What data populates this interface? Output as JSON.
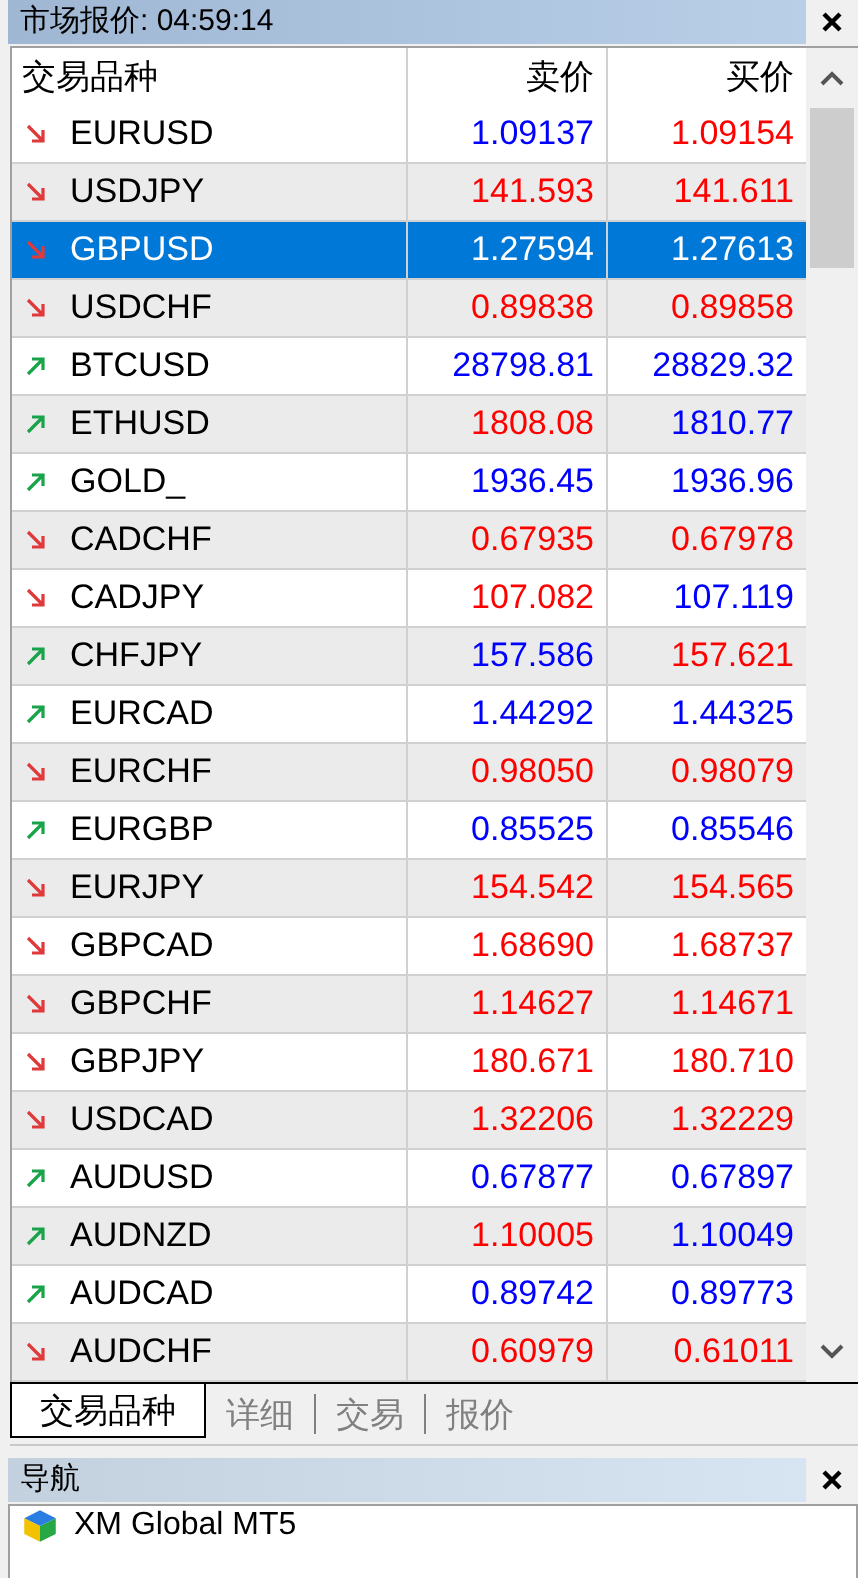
{
  "market_watch": {
    "title": "市场报价: 04:59:14",
    "columns": [
      "交易品种",
      "卖价",
      "买价"
    ],
    "rows": [
      {
        "symbol": "EURUSD",
        "rising": false,
        "bid": "1.09137",
        "bid_up": true,
        "ask": "1.09154",
        "ask_up": false,
        "selected": false
      },
      {
        "symbol": "USDJPY",
        "rising": false,
        "bid": "141.593",
        "bid_up": false,
        "ask": "141.611",
        "ask_up": false,
        "selected": false
      },
      {
        "symbol": "GBPUSD",
        "rising": false,
        "bid": "1.27594",
        "ask": "1.27613",
        "selected": true
      },
      {
        "symbol": "USDCHF",
        "rising": false,
        "bid": "0.89838",
        "bid_up": false,
        "ask": "0.89858",
        "ask_up": false,
        "selected": false
      },
      {
        "symbol": "BTCUSD",
        "rising": true,
        "bid": "28798.81",
        "bid_up": true,
        "ask": "28829.32",
        "ask_up": true,
        "selected": false
      },
      {
        "symbol": "ETHUSD",
        "rising": true,
        "bid": "1808.08",
        "bid_up": false,
        "ask": "1810.77",
        "ask_up": true,
        "selected": false
      },
      {
        "symbol": "GOLD_",
        "rising": true,
        "bid": "1936.45",
        "bid_up": true,
        "ask": "1936.96",
        "ask_up": true,
        "selected": false
      },
      {
        "symbol": "CADCHF",
        "rising": false,
        "bid": "0.67935",
        "bid_up": false,
        "ask": "0.67978",
        "ask_up": false,
        "selected": false
      },
      {
        "symbol": "CADJPY",
        "rising": false,
        "bid": "107.082",
        "bid_up": false,
        "ask": "107.119",
        "ask_up": true,
        "selected": false
      },
      {
        "symbol": "CHFJPY",
        "rising": true,
        "bid": "157.586",
        "bid_up": true,
        "ask": "157.621",
        "ask_up": false,
        "selected": false
      },
      {
        "symbol": "EURCAD",
        "rising": true,
        "bid": "1.44292",
        "bid_up": true,
        "ask": "1.44325",
        "ask_up": true,
        "selected": false
      },
      {
        "symbol": "EURCHF",
        "rising": false,
        "bid": "0.98050",
        "bid_up": false,
        "ask": "0.98079",
        "ask_up": false,
        "selected": false
      },
      {
        "symbol": "EURGBP",
        "rising": true,
        "bid": "0.85525",
        "bid_up": true,
        "ask": "0.85546",
        "ask_up": true,
        "selected": false
      },
      {
        "symbol": "EURJPY",
        "rising": false,
        "bid": "154.542",
        "bid_up": false,
        "ask": "154.565",
        "ask_up": false,
        "selected": false
      },
      {
        "symbol": "GBPCAD",
        "rising": false,
        "bid": "1.68690",
        "bid_up": false,
        "ask": "1.68737",
        "ask_up": false,
        "selected": false
      },
      {
        "symbol": "GBPCHF",
        "rising": false,
        "bid": "1.14627",
        "bid_up": false,
        "ask": "1.14671",
        "ask_up": false,
        "selected": false
      },
      {
        "symbol": "GBPJPY",
        "rising": false,
        "bid": "180.671",
        "bid_up": false,
        "ask": "180.710",
        "ask_up": false,
        "selected": false
      },
      {
        "symbol": "USDCAD",
        "rising": false,
        "bid": "1.32206",
        "bid_up": false,
        "ask": "1.32229",
        "ask_up": false,
        "selected": false
      },
      {
        "symbol": "AUDUSD",
        "rising": true,
        "bid": "0.67877",
        "bid_up": true,
        "ask": "0.67897",
        "ask_up": true,
        "selected": false
      },
      {
        "symbol": "AUDNZD",
        "rising": true,
        "bid": "1.10005",
        "bid_up": false,
        "ask": "1.10049",
        "ask_up": true,
        "selected": false
      },
      {
        "symbol": "AUDCAD",
        "rising": true,
        "bid": "0.89742",
        "bid_up": true,
        "ask": "0.89773",
        "ask_up": true,
        "selected": false
      },
      {
        "symbol": "AUDCHF",
        "rising": false,
        "bid": "0.60979",
        "bid_up": false,
        "ask": "0.61011",
        "ask_up": false,
        "selected": false
      }
    ],
    "tabs": [
      {
        "label": "交易品种",
        "selected": true
      },
      {
        "label": "详细",
        "selected": false
      },
      {
        "label": "交易",
        "selected": false
      },
      {
        "label": "报价",
        "selected": false
      }
    ]
  },
  "navigator": {
    "title": "导航",
    "items": [
      {
        "label": "XM Global MT5"
      }
    ]
  }
}
